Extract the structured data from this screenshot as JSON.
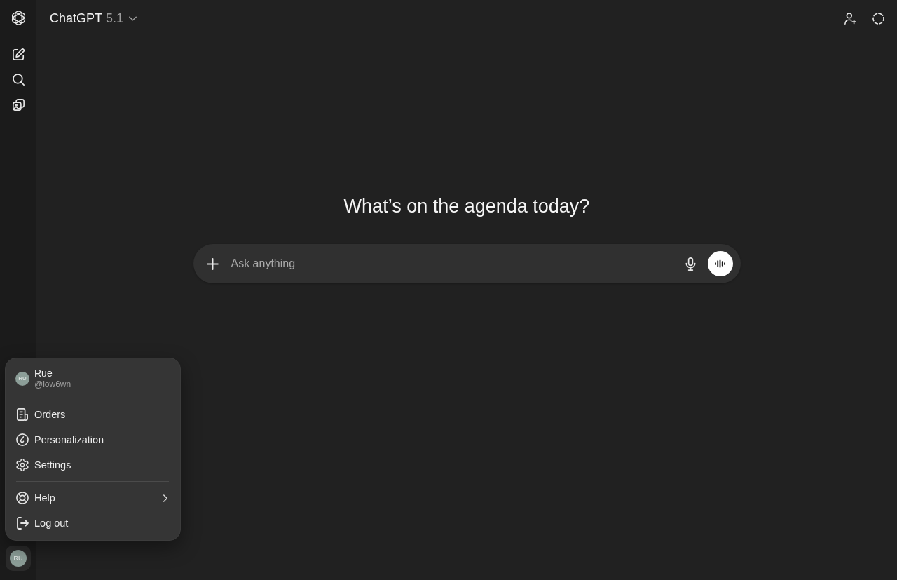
{
  "header": {
    "title": "ChatGPT",
    "version": "5.1"
  },
  "main": {
    "heading": "What’s on the agenda today?",
    "composer": {
      "placeholder": "Ask anything"
    }
  },
  "account_menu": {
    "profile": {
      "initials": "RU",
      "name": "Rue",
      "handle": "@iow6wn"
    },
    "sections": [
      {
        "items": [
          {
            "label": "Orders",
            "submenu": false
          },
          {
            "label": "Personalization",
            "submenu": false
          },
          {
            "label": "Settings",
            "submenu": false
          }
        ]
      },
      {
        "items": [
          {
            "label": "Help",
            "submenu": true
          },
          {
            "label": "Log out",
            "submenu": false
          }
        ]
      }
    ]
  },
  "sidebar": {
    "account": {
      "initials": "RU",
      "expanded": true
    }
  }
}
